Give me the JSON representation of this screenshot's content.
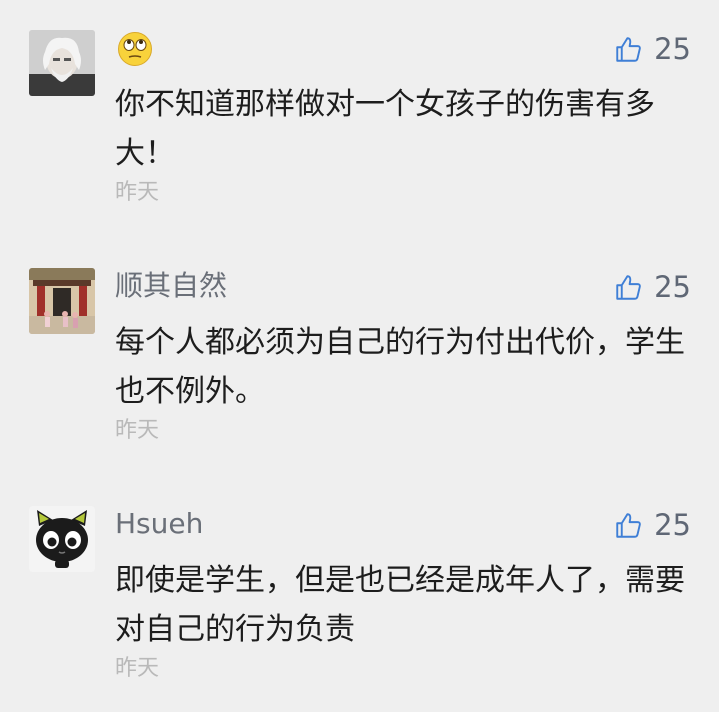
{
  "comments": [
    {
      "author": "",
      "author_emoji": "rolling-eyes-emoji",
      "likes": "25",
      "text": "你不知道那样做对一个女孩子的伤害有多大！",
      "time": "昨天"
    },
    {
      "author": "顺其自然",
      "likes": "25",
      "text": "每个人都必须为自己的行为付出代价，学生也不例外。",
      "time": "昨天"
    },
    {
      "author": "Hsueh",
      "likes": "25",
      "text": "即使是学生，但是也已经是成年人了，需要对自己的行为负责",
      "time": "昨天"
    }
  ],
  "icons": {
    "like": "thumbs-up-icon"
  },
  "colors": {
    "background": "#efefef",
    "author": "#6a6f78",
    "body_text": "#1d1d1d",
    "timestamp": "#b9b9b9",
    "like": "#5f6775"
  }
}
